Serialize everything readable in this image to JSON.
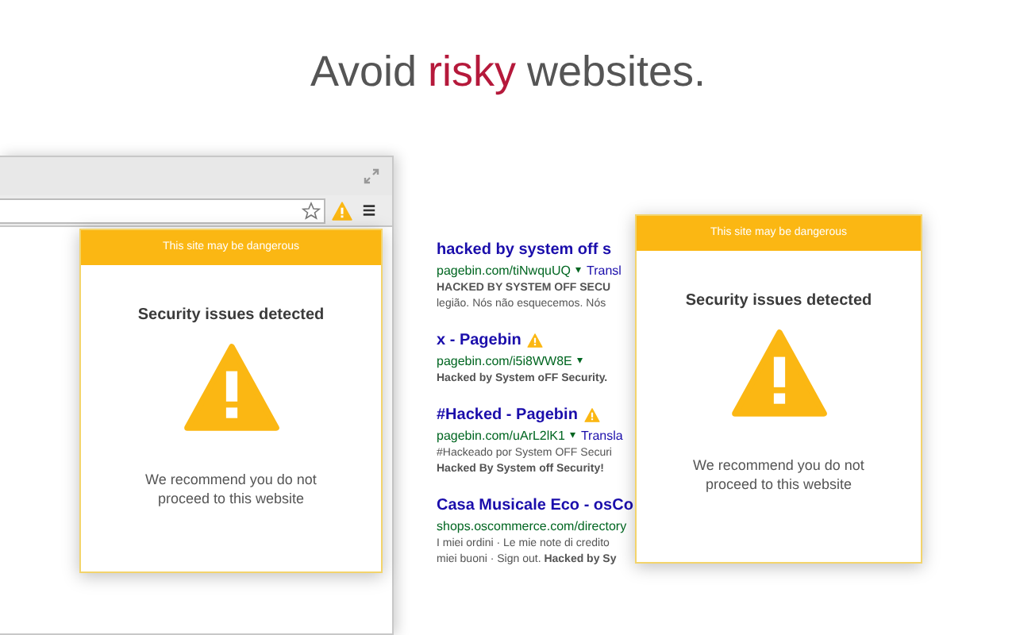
{
  "headline": [
    {
      "text": "Avoid",
      "accent": false
    },
    {
      "text": "risky",
      "accent": true
    },
    {
      "text": "websites.",
      "accent": false
    }
  ],
  "browser_popup": {
    "header": "This site may be dangerous",
    "heading": "Security issues detected",
    "message": "We recommend you do not proceed to this website"
  },
  "results": [
    {
      "title": "hacked by system off s",
      "warning": false,
      "url": "pagebin.com/tiNwquUQ",
      "arrow": "▾",
      "translate": "Transl",
      "snippets": [
        "**HACKED BY SYSTEM OFF SECU**",
        "legião. Nós não esquecemos. Nós"
      ]
    },
    {
      "title": "x - Pagebin",
      "warning": true,
      "url": "pagebin.com/i5i8WW8E",
      "arrow": "▾",
      "snippets": [
        "**Hacked by System oFF Security.**"
      ]
    },
    {
      "title": "#Hacked - Pagebin",
      "warning": true,
      "url": "pagebin.com/uArL2lK1",
      "arrow": "▾",
      "translate": "Transla",
      "snippets": [
        "#Hackeado por System OFF Securi",
        "**Hacked By System off Security!**"
      ]
    },
    {
      "title": "Casa Musicale Eco - osCo",
      "warning": false,
      "url": "shops.oscommerce.com/directory",
      "snippets": [
        "I miei ordini · Le mie note di credito",
        "miei buoni · Sign out. **Hacked by Sy**"
      ]
    }
  ],
  "page_popup": {
    "header": "This site may be dangerous",
    "heading": "Security issues detected",
    "message": "We recommend you do not proceed to this website"
  }
}
